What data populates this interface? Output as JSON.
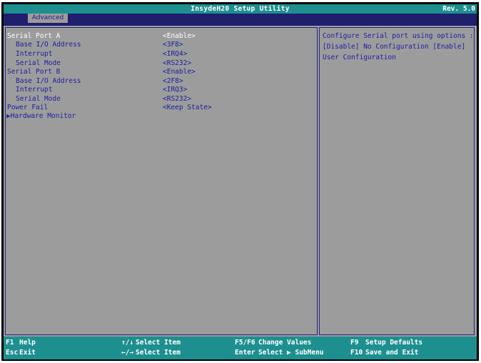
{
  "header": {
    "title": "InsydeH20 Setup Utility",
    "revision": "Rev. 5.0"
  },
  "tabs": [
    {
      "label": "Advanced",
      "active": true
    }
  ],
  "settings": [
    {
      "label": "Serial Port A",
      "value": "<Enable>",
      "indent": false,
      "selected": true
    },
    {
      "label": "Base I/O Address",
      "value": "<3F8>",
      "indent": true,
      "selected": false
    },
    {
      "label": "Interrupt",
      "value": "<IRQ4>",
      "indent": true,
      "selected": false
    },
    {
      "label": "Serial Mode",
      "value": "<RS232>",
      "indent": true,
      "selected": false
    },
    {
      "label": "Serial Port B",
      "value": "<Enable>",
      "indent": false,
      "selected": false
    },
    {
      "label": "Base I/O Address",
      "value": "<2F8>",
      "indent": true,
      "selected": false
    },
    {
      "label": "Interrupt",
      "value": "<IRQ3>",
      "indent": true,
      "selected": false
    },
    {
      "label": "Serial Mode",
      "value": "<RS232>",
      "indent": true,
      "selected": false
    },
    {
      "label": "Power Fail",
      "value": "<Keep State>",
      "indent": false,
      "selected": false
    },
    {
      "label": "▶Hardware Monitor",
      "value": "",
      "indent": false,
      "selected": false
    }
  ],
  "help_text": "Configure Serial port using options : [Disable] No Configuration [Enable] User Configuration",
  "footer": [
    {
      "key": "F1",
      "desc": "Help"
    },
    {
      "key": "Esc",
      "desc": "Exit"
    },
    {
      "key": "↑/↓",
      "desc": "Select Item"
    },
    {
      "key": "←/→",
      "desc": "Select Item"
    },
    {
      "key": "F5/F6",
      "desc": "Change Values"
    },
    {
      "key": "Enter",
      "desc": "Select ▶ SubMenu"
    },
    {
      "key": "F9",
      "desc": "Setup Defaults"
    },
    {
      "key": "F10",
      "desc": "Save and Exit"
    }
  ],
  "colors": {
    "title_bar": "#1e8f8f",
    "tab_bar": "#1f1f6e",
    "panel": "#9c9c9c",
    "text": "#2020a0",
    "selected_text": "#ffffff"
  }
}
